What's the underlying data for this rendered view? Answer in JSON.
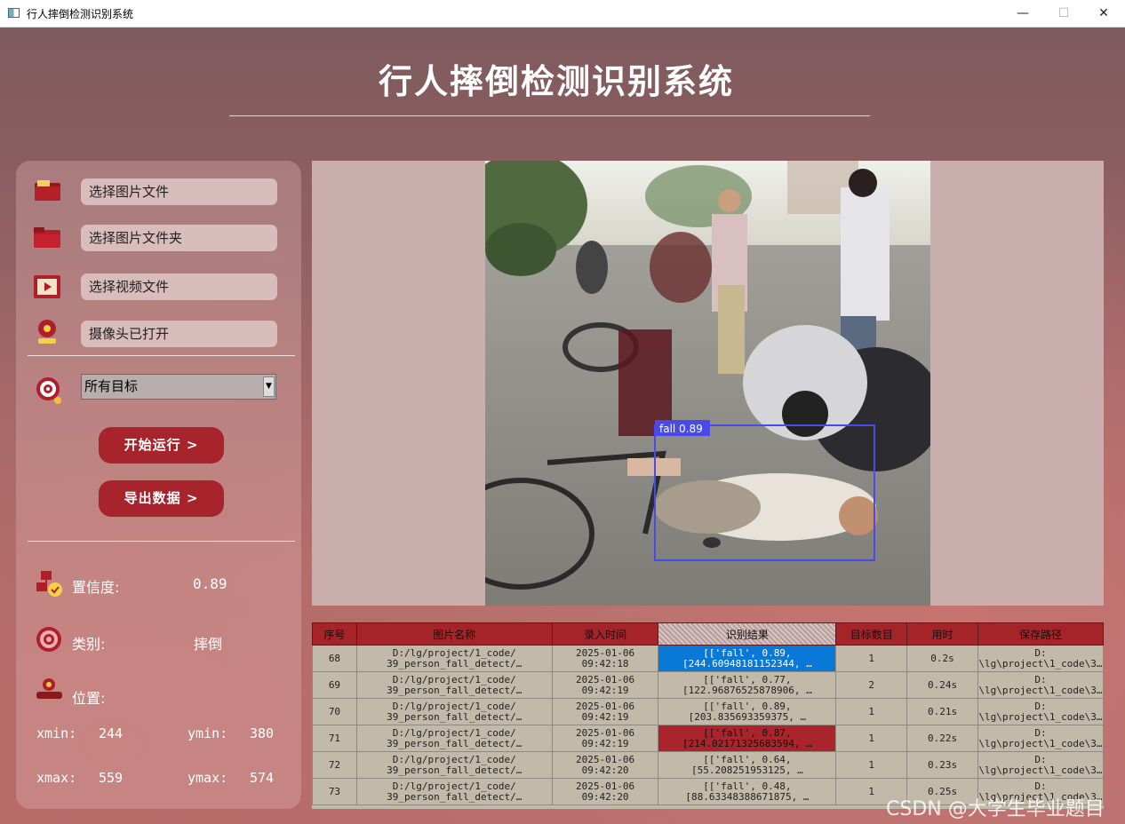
{
  "window": {
    "title": "行人摔倒检测识别系统",
    "minimize": "—",
    "maximize": "☐",
    "close": "✕"
  },
  "app_title": "行人摔倒检测识别系统",
  "sidebar": {
    "file_buttons": [
      {
        "label": "选择图片文件",
        "icon": "image-file-icon"
      },
      {
        "label": "选择图片文件夹",
        "icon": "folder-icon"
      },
      {
        "label": "选择视频文件",
        "icon": "video-icon"
      },
      {
        "label": "摄像头已打开",
        "icon": "camera-icon"
      }
    ],
    "target_select": {
      "value": "所有目标",
      "icon": "target-icon"
    },
    "run_button": "开始运行 >",
    "export_button": "导出数据 >"
  },
  "info": {
    "confidence_label": "置信度:",
    "confidence_value": "0.89",
    "class_label": "类别:",
    "class_value": "摔倒",
    "position_label": "位置:",
    "xmin_label": "xmin:",
    "xmin": "244",
    "ymin_label": "ymin:",
    "ymin": "380",
    "xmax_label": "xmax:",
    "xmax": "559",
    "ymax_label": "ymax:",
    "ymax": "574"
  },
  "detection": {
    "label": "fall 0.89",
    "box_color": "#4a4ae8"
  },
  "table": {
    "headers": [
      "序号",
      "图片名称",
      "录入时间",
      "识别结果",
      "目标数目",
      "用时",
      "保存路径"
    ],
    "rows": [
      {
        "id": "68",
        "name1": "D:/lg/project/1_code/",
        "name2": "39_person_fall_detect/…",
        "time1": "2025-01-06",
        "time2": "09:42:18",
        "res1": "[['fall', 0.89,",
        "res2": "[244.60948181152344, …",
        "count": "1",
        "dur": "0.2s",
        "path1": "D:",
        "path2": "\\lg\\project\\1_code\\3…",
        "hl": "blue"
      },
      {
        "id": "69",
        "name1": "D:/lg/project/1_code/",
        "name2": "39_person_fall_detect/…",
        "time1": "2025-01-06",
        "time2": "09:42:19",
        "res1": "[['fall', 0.77,",
        "res2": "[122.96876525878906, …",
        "count": "2",
        "dur": "0.24s",
        "path1": "D:",
        "path2": "\\lg\\project\\1_code\\3…",
        "hl": ""
      },
      {
        "id": "70",
        "name1": "D:/lg/project/1_code/",
        "name2": "39_person_fall_detect/…",
        "time1": "2025-01-06",
        "time2": "09:42:19",
        "res1": "[['fall', 0.89,",
        "res2": "[203.835693359375, …",
        "count": "1",
        "dur": "0.21s",
        "path1": "D:",
        "path2": "\\lg\\project\\1_code\\3…",
        "hl": ""
      },
      {
        "id": "71",
        "name1": "D:/lg/project/1_code/",
        "name2": "39_person_fall_detect/…",
        "time1": "2025-01-06",
        "time2": "09:42:19",
        "res1": "[['fall', 0.87,",
        "res2": "[214.02171325683594, …",
        "count": "1",
        "dur": "0.22s",
        "path1": "D:",
        "path2": "\\lg\\project\\1_code\\3…",
        "hl": "red"
      },
      {
        "id": "72",
        "name1": "D:/lg/project/1_code/",
        "name2": "39_person_fall_detect/…",
        "time1": "2025-01-06",
        "time2": "09:42:20",
        "res1": "[['fall', 0.64,",
        "res2": "[55.208251953125, …",
        "count": "1",
        "dur": "0.23s",
        "path1": "D:",
        "path2": "\\lg\\project\\1_code\\3…",
        "hl": ""
      },
      {
        "id": "73",
        "name1": "D:/lg/project/1_code/",
        "name2": "39_person_fall_detect/…",
        "time1": "2025-01-06",
        "time2": "09:42:20",
        "res1": "[['fall', 0.48,",
        "res2": "[88.63348388671875, …",
        "count": "1",
        "dur": "0.25s",
        "path1": "D:",
        "path2": "\\lg\\project\\1_code\\3…",
        "hl": ""
      }
    ]
  },
  "watermark": "CSDN @大学生毕业题目"
}
